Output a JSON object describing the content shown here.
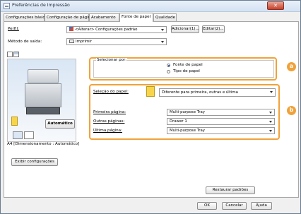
{
  "window": {
    "title": "Preferências de Impressão",
    "close_label": "✕"
  },
  "tabs": [
    {
      "label": "Configurações básicas",
      "accel": ""
    },
    {
      "label": "Configuração de página",
      "accel": ""
    },
    {
      "label": "Acabamento",
      "accel": ""
    },
    {
      "label": "Fonte de papel",
      "accel": ""
    },
    {
      "label": "Qualidade",
      "accel": ""
    }
  ],
  "profile": {
    "label": "Perfil:",
    "value": "<Alterar> Configurações padrão",
    "add_button": "Adicionar(1)...",
    "edit_button": "Editar(2)..."
  },
  "output_method": {
    "label": "Método de saída:",
    "value": "Imprimir"
  },
  "preview": {
    "auto_button": "Automático",
    "caption": "A4 [Dimensionamento : Automático]",
    "show_settings_button": "Exibir configurações"
  },
  "select_by": {
    "label": "Selecionar por:",
    "options": [
      "Fonte de papel",
      "Tipo de papel"
    ],
    "selected": 0
  },
  "paper_selection": {
    "label": "Seleção do papel:",
    "value": "Diferente para primeira, outras e última"
  },
  "first_page": {
    "label": "Primeira página:",
    "value": "Multi-purpose Tray"
  },
  "other_pages": {
    "label": "Outras páginas:",
    "value": "Drawer 1"
  },
  "last_page": {
    "label": "Última página:",
    "value": "Multi-purpose Tray"
  },
  "callouts": {
    "a": "a",
    "b": "b"
  },
  "restore_button": "Restaurar padrões",
  "footer": {
    "ok": "OK",
    "cancel": "Cancelar",
    "help": "Ajuda"
  },
  "colors": {
    "accent": "#f0a23a",
    "title_bar": "#d4e2f2"
  }
}
